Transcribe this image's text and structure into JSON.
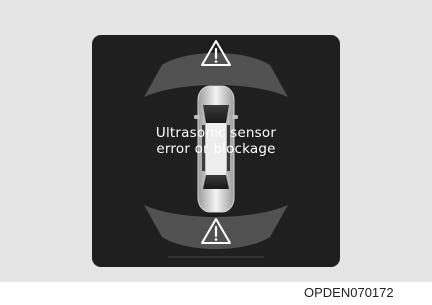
{
  "display": {
    "message_line1": "Ultrasonic sensor",
    "message_line2": "error or blockage",
    "front_warning_icon": "warning-triangle-icon",
    "rear_warning_icon": "warning-triangle-icon",
    "vehicle_icon": "car-top-view-icon"
  },
  "figure_code": "OPDEN070172",
  "colors": {
    "panel_background": "#e5e5e5",
    "display_background": "#1f1f1f",
    "sensor_zone": "#5a5a5a",
    "text": "#ffffff"
  }
}
